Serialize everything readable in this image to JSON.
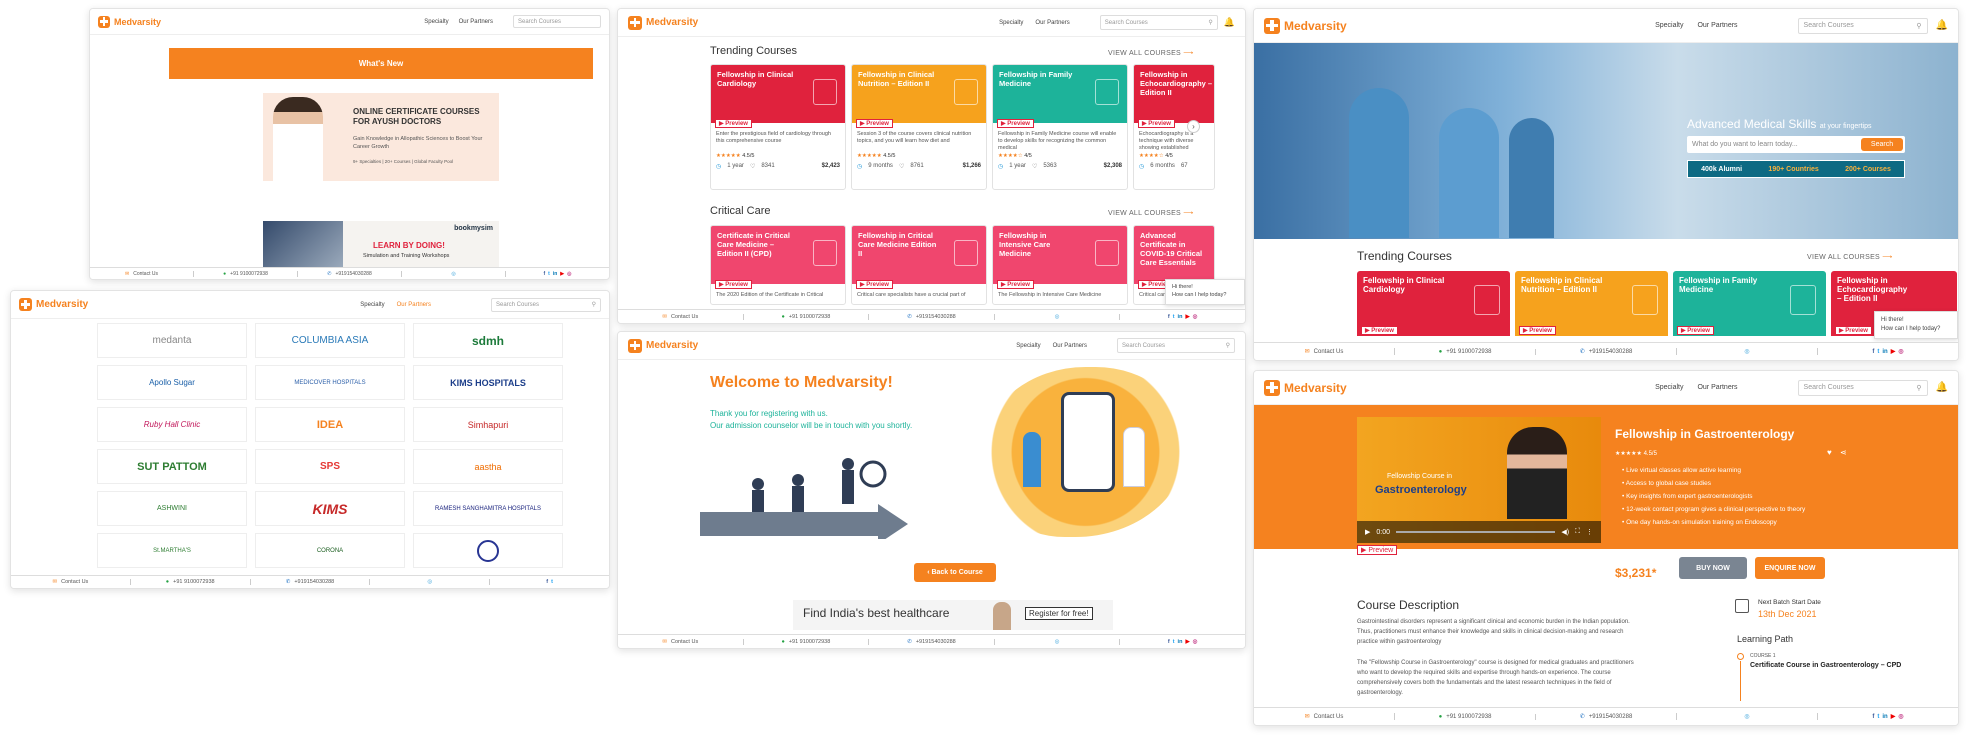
{
  "brand": {
    "name": "Medvarsity",
    "color": "#f5821f"
  },
  "nav": {
    "specialty": "Specialty",
    "partners": "Our Partners",
    "search_placeholder": "Search Courses"
  },
  "footer": {
    "contact": "Contact Us",
    "whatsapp": "+91 9100072938",
    "phone": "+919154030288"
  },
  "whats_new": {
    "title": "What's New",
    "banner1_title": "ONLINE CERTIFICATE COURSES FOR AYUSH DOCTORS",
    "banner1_sub": "Gain Knowledge in Allopathic Sciences to Boost Your Career Growth",
    "banner1_stats": "9+ Specialties | 20+ Courses | Global Faculty Pool",
    "banner2_title": "LEARN BY DOING!",
    "banner2_sub": "Simulation and Training Workshops",
    "banner2_brand": "bookmysim"
  },
  "partners": [
    "medanta",
    "COLUMBIA ASIA",
    "sdmh",
    "Apollo Sugar",
    "MEDICOVER HOSPITALS",
    "KIMS HOSPITALS",
    "Ruby Hall Clinic",
    "IDEA",
    "Simhapuri",
    "SUT PATTOM",
    "SPS",
    "aastha",
    "ASHWINI",
    "KIMS",
    "RAMESH SANGHAMITRA HOSPITALS",
    "St.MARTHA'S",
    "CORONA",
    "emblem"
  ],
  "trending": {
    "title": "Trending Courses",
    "view_all": "VIEW ALL COURSES",
    "cards": [
      {
        "title": "Fellowship in Clinical Cardiology",
        "desc": "Enter the prestigious field of cardiology through this comprehensive course",
        "rating": "4.5/5",
        "duration": "1 year",
        "likes": "8341",
        "price": "$2,423",
        "color": "#e0223d"
      },
      {
        "title": "Fellowship in Clinical Nutrition – Edition II",
        "desc": "Session 3 of the course covers clinical nutrition topics, and you will learn how diet and",
        "rating": "4.5/5",
        "duration": "9 months",
        "likes": "8761",
        "price": "$1,266",
        "color": "#f6a21d"
      },
      {
        "title": "Fellowship in Family Medicine",
        "desc": "Fellowship in Family Medicine course will enable to develop skills for recognizing the common medical",
        "rating": "4/5",
        "duration": "1 year",
        "likes": "5363",
        "price": "$2,308",
        "color": "#1db39a"
      },
      {
        "title": "Fellowship in Echocardiography – Edition II",
        "desc": "Echocardiography is a technique with diverse showing established",
        "rating": "4/5",
        "duration": "6 months",
        "likes": "67",
        "price": "",
        "color": "#e0223d"
      }
    ]
  },
  "critical": {
    "title": "Critical Care",
    "view_all": "VIEW ALL COURSES",
    "cards": [
      {
        "title": "Certificate in Critical Care Medicine – Edition II (CPD)",
        "desc": "The 2020 Edition of the Certificate in Critical",
        "color": "#f0466e"
      },
      {
        "title": "Fellowship in Critical Care Medicine Edition II",
        "desc": "Critical care specialists have a crucial part of",
        "color": "#f0466e"
      },
      {
        "title": "Fellowship in Intensive Care Medicine",
        "desc": "The Fellowship in Intensive Care Medicine",
        "color": "#f0466e"
      },
      {
        "title": "Advanced Certificate in COVID-19 Critical Care Essentials",
        "desc": "Critical care",
        "color": "#f0466e"
      }
    ]
  },
  "preview_label": "Preview",
  "chat": {
    "line1": "Hi there!",
    "line2": "How can I help today?"
  },
  "hero": {
    "title": "Advanced Medical Skills",
    "suffix": "at your fingertips",
    "placeholder": "What do you want to learn today...",
    "search": "Search",
    "alumni": "400k Alumni",
    "countries": "190+ Countries",
    "courses": "200+ Courses"
  },
  "welcome": {
    "title": "Welcome to Medvarsity!",
    "line1": "Thank you for registering with us.",
    "line2": "Our admission counselor will be in touch with you shortly.",
    "back": "‹ Back to Course",
    "find": "Find India's best healthcare",
    "register": "Register for free!"
  },
  "course": {
    "title": "Fellowship in Gastroenterology",
    "rating": "4.5/5",
    "video_label1": "Fellowship Course in",
    "video_label2": "Gastroenterology",
    "time": "0:00",
    "bullets": [
      "Live virtual classes allow active learning",
      "Access to global case studies",
      "Key insights from expert gastroenterologists",
      "12-week contact program gives a clinical perspective to theory",
      "One day hands-on simulation training on Endoscopy"
    ],
    "price": "$3,231*",
    "buy": "BUY NOW",
    "enquire": "ENQUIRE NOW",
    "desc_title": "Course Description",
    "desc1": "Gastrointestinal disorders represent a significant clinical and economic burden in the Indian population. Thus, practitioners must enhance their knowledge and skills in clinical decision-making and research practice within gastroenterology",
    "desc2": "The \"Fellowship Course in Gastroenterology\" course is designed for medical graduates and practitioners who want to develop the required skills and expertise through hands-on experience. The course comprehensively covers both the fundamentals and the latest research techniques in the field of gastroenterology.",
    "batch_label": "Next Batch Start Date",
    "batch_date": "13th Dec 2021",
    "path_title": "Learning Path",
    "path_course": "COURSE 1",
    "path_name": "Certificate Course in Gastroenterology – CPD"
  }
}
